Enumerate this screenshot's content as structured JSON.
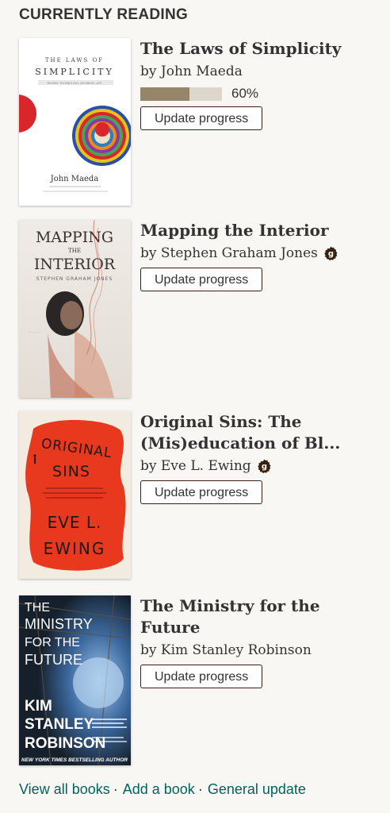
{
  "section": {
    "title": "CURRENTLY READING"
  },
  "books": [
    {
      "title": "The Laws of Simplicity",
      "author": "by John Maeda",
      "progress_percent": 60,
      "progress_label": "60%",
      "button_label": "Update progress",
      "cover": {
        "title_line1": "THE LAWS OF",
        "title_line2": "SIMPLICITY",
        "subtitle": "DESIGN, TECHNOLOGY, BUSINESS, LIFE",
        "author": "John Maeda",
        "background": "#ffffff",
        "accent": "#d9262b"
      }
    },
    {
      "title": "Mapping the Interior",
      "author": "by Stephen Graham Jones",
      "has_goodreads_author_badge": true,
      "button_label": "Update progress",
      "cover": {
        "title_line1": "MAPPING",
        "title_line2": "THE",
        "title_line3": "INTERIOR",
        "author": "STEPHEN GRAHAM JONES",
        "background": "#eae6e0"
      }
    },
    {
      "title": "Original Sins: The (Mis)education of Bl...",
      "author": "by Eve L. Ewing",
      "has_goodreads_author_badge": true,
      "button_label": "Update progress",
      "cover": {
        "title_line1": "ORIGINAL",
        "title_line2": "SINS",
        "author_line1": "EVE L.",
        "author_line2": "EWING",
        "background": "#f2ece0",
        "accent": "#e8381e"
      }
    },
    {
      "title": "The Ministry for the Future",
      "author": "by Kim Stanley Robinson",
      "button_label": "Update progress",
      "cover": {
        "title_line1": "THE",
        "title_line2": "MINISTRY",
        "title_line3": "FOR THE",
        "title_line4": "FUTURE",
        "author_line1": "KIM",
        "author_line2": "STANLEY",
        "author_line3": "ROBINSON",
        "tagline": "NEW YORK TIMES BESTSELLING AUTHOR",
        "background": "#1d2530"
      }
    }
  ],
  "footer": {
    "view_all": "View all books",
    "add_book": "Add a book",
    "general_update": "General update"
  },
  "colors": {
    "link": "#00635d",
    "button_border": "#382110",
    "progress_fill": "#968568",
    "progress_track": "#dcd6cc",
    "badge": "#382110"
  }
}
